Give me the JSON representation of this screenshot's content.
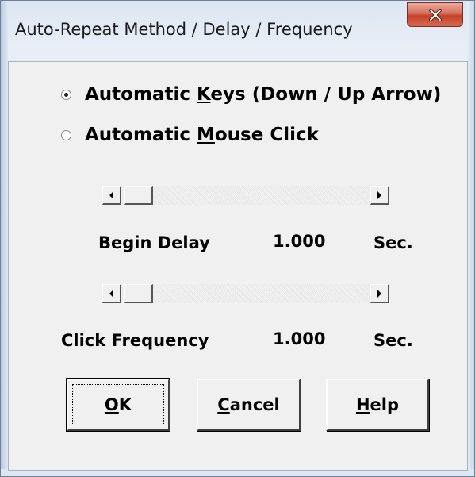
{
  "window": {
    "title": "Auto-Repeat Method / Delay / Frequency",
    "close_glyph": "X"
  },
  "method": {
    "options": [
      {
        "pre": "Automatic ",
        "mnemonic": "K",
        "post": "eys (Down / Up Arrow)",
        "checked": true
      },
      {
        "pre": "Automatic ",
        "mnemonic": "M",
        "post": "ouse Click",
        "checked": false
      }
    ]
  },
  "begin_delay": {
    "label": "Begin Delay",
    "value": "1.000",
    "unit": "Sec.",
    "slider_position": 0.0
  },
  "click_frequency": {
    "label": "Click Frequency",
    "value": "1.000",
    "unit": "Sec.",
    "slider_position": 0.0
  },
  "buttons": {
    "ok": {
      "mnemonic": "O",
      "rest": "K"
    },
    "cancel": {
      "mnemonic": "C",
      "rest": "ancel"
    },
    "help": {
      "mnemonic": "H",
      "rest": "elp"
    }
  },
  "colors": {
    "close_button": "#c4402a",
    "client_background": "#f0f0f0"
  }
}
